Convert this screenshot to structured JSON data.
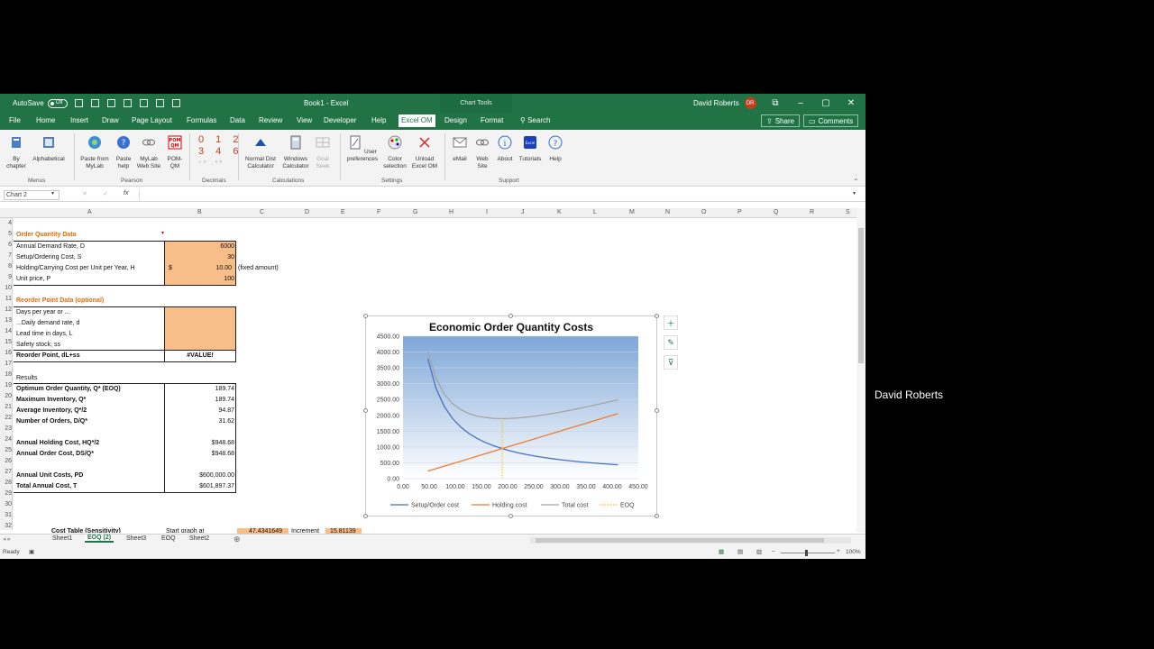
{
  "window": {
    "autosave_label": "AutoSave",
    "autosave_state": "Off",
    "doc_title": "Book1 - Excel",
    "chart_tools": "Chart Tools",
    "user_name": "David Roberts",
    "user_initials": "DR",
    "min": "–",
    "max": "▢",
    "close": "✕",
    "restore": "⧉"
  },
  "tabs": [
    "File",
    "Home",
    "Insert",
    "Draw",
    "Page Layout",
    "Formulas",
    "Data",
    "Review",
    "View",
    "Developer",
    "Help",
    "Excel OM",
    "Design",
    "Format"
  ],
  "search_label": "Search",
  "share_label": "Share",
  "comments_label": "Comments",
  "ribbon": {
    "buttons": [
      {
        "label": "By\nchapter",
        "icon": "chapter-icon"
      },
      {
        "label": "Alphabetical",
        "icon": "alphabetical-icon"
      },
      {
        "label": "Paste from\nMyLab",
        "icon": "mylab-icon"
      },
      {
        "label": "Paste\nhelp",
        "icon": "help-icon"
      },
      {
        "label": "MyLab\nWeb Site",
        "icon": "web-icon"
      },
      {
        "label": "POM-\nQM",
        "icon": "pomqm-icon"
      },
      {
        "label": "Normal Dist\nCalculator",
        "icon": "normal-dist-icon"
      },
      {
        "label": "Windows\nCalculator",
        "icon": "calculator-icon"
      },
      {
        "label": "Goal\nSeek",
        "icon": "goal-seek-icon"
      },
      {
        "label": "User\npreferences",
        "icon": "preferences-icon"
      },
      {
        "label": "Color\nselection",
        "icon": "color-icon"
      },
      {
        "label": "Unload\nExcel OM",
        "icon": "unload-icon"
      },
      {
        "label": "eMail",
        "icon": "mail-icon"
      },
      {
        "label": "Web\nSite",
        "icon": "link-icon"
      },
      {
        "label": "About",
        "icon": "info-icon"
      },
      {
        "label": "Tutorials",
        "icon": "tutorials-icon"
      },
      {
        "label": "Help",
        "icon": "question-icon"
      }
    ],
    "digits_top": "0 1 2",
    "digits_mid": "3 4 6",
    "digits_bot": "⁺⁰ .⁰⁰",
    "groups": [
      "Menus",
      "Pearson",
      "Decimals",
      "Calculations",
      "Settings",
      "Support"
    ],
    "pom_line1": "POM",
    "pom_line2": "QM",
    "tutorials_mark": "Excel"
  },
  "formula_bar": {
    "name_box": "Chart 2",
    "fx": "fx"
  },
  "columns": [
    "A",
    "B",
    "C",
    "D",
    "E",
    "F",
    "G",
    "H",
    "I",
    "J",
    "K",
    "L",
    "M",
    "N",
    "O",
    "P",
    "Q",
    "R",
    "S"
  ],
  "rows": [
    "4",
    "5",
    "6",
    "7",
    "8",
    "9",
    "10",
    "11",
    "12",
    "13",
    "14",
    "15",
    "16",
    "17",
    "18",
    "19",
    "20",
    "21",
    "22",
    "23",
    "24",
    "25",
    "26",
    "27",
    "28",
    "29",
    "30",
    "31",
    "32"
  ],
  "sheet": {
    "oq_header": "Order Quantity Data",
    "r6a": "Annual Demand Rate, D",
    "r6b": "6000",
    "r7a": "Setup/Ordering Cost, S",
    "r7b": "30",
    "r8a": "Holding/Carrying Cost per Unit per Year, H",
    "r8cur": "$",
    "r8b": "10.00",
    "r8c": "(fixed amount)",
    "r9a": "Unit price, P",
    "r9b": "100",
    "rp_header": "Reorder Point Data (optional)",
    "r12a": "Days per year or ...",
    "r13a": "...Daily demand rate, d",
    "r14a": "Lead time in days, L",
    "r15a": "Safety stock, ss",
    "r16a": "Reorder Point, dL+ss",
    "r16b": "#VALUE!",
    "results": "Results",
    "r19a": "Optimum Order Quantity, Q* (EOQ)",
    "r19b": "189.74",
    "r20a": "Maximum Inventory, Q*",
    "r20b": "189.74",
    "r21a": "Average Inventory, Q*/2",
    "r21b": "94.87",
    "r22a": "Number of Orders, D/Q*",
    "r22b": "31.62",
    "r24a": "Annual Holding Cost, HQ*/2",
    "r24b": "$948.68",
    "r25a": "Annual Order Cost, DS/Q*",
    "r25b": "$948.68",
    "r27a": "Annual Unit Costs, PD",
    "r27b": "$600,000.00",
    "r28a": "Total Annual Cost, T",
    "r28b": "$601,897.37",
    "r32a": "Cost Table (Sensitivity)",
    "r32b": "Start graph at",
    "r32c": "47.4341649",
    "r32d": "Increment",
    "r32e": "15.81139"
  },
  "sheet_tabs": [
    "Sheet1",
    "EOQ (2)",
    "Sheet3",
    "EOQ",
    "Sheet2"
  ],
  "status": {
    "ready": "Ready",
    "zoom": "100%"
  },
  "side_name": "David Roberts",
  "chart_tool_icons": [
    "plus-icon",
    "brush-icon",
    "filter-icon"
  ],
  "colors": {
    "setup": "#4472c4",
    "holding": "#ed7d31",
    "total": "#a5a5a5",
    "eoq": "#ffc000"
  },
  "chart_data": {
    "type": "line",
    "title": "Economic Order Quantity Costs",
    "xlim": [
      0,
      450
    ],
    "ylim": [
      0,
      4500
    ],
    "xticks": [
      "0.00",
      "50.00",
      "100.00",
      "150.00",
      "200.00",
      "250.00",
      "300.00",
      "350.00",
      "400.00",
      "450.00"
    ],
    "yticks": [
      "0.00",
      "500.00",
      "1000.00",
      "1500.00",
      "2000.00",
      "2500.00",
      "3000.00",
      "3500.00",
      "4000.00",
      "4500.00"
    ],
    "x": [
      47.43,
      63.25,
      79.06,
      94.87,
      110.68,
      126.49,
      142.3,
      158.11,
      173.93,
      189.74,
      205.55,
      221.36,
      237.17,
      252.98,
      268.79,
      284.6,
      300.42,
      316.23,
      332.04,
      347.85,
      363.66,
      379.47,
      395.28,
      411.09
    ],
    "series": [
      {
        "name": "Setup/Order cost",
        "values": [
          3795,
          2846,
          2277,
          1897,
          1626,
          1423,
          1265,
          1138,
          1035,
          949,
          876,
          813,
          759,
          712,
          670,
          632,
          599,
          569,
          542,
          517,
          495,
          474,
          455,
          438
        ]
      },
      {
        "name": "Holding cost",
        "values": [
          237,
          316,
          395,
          474,
          553,
          632,
          712,
          791,
          870,
          949,
          1028,
          1107,
          1186,
          1265,
          1344,
          1423,
          1502,
          1581,
          1660,
          1739,
          1818,
          1897,
          1976,
          2055
        ]
      },
      {
        "name": "Total cost",
        "values": [
          4032,
          3162,
          2672,
          2371,
          2179,
          2055,
          1977,
          1929,
          1905,
          1897,
          1904,
          1920,
          1945,
          1977,
          2014,
          2055,
          2101,
          2150,
          2202,
          2256,
          2313,
          2371,
          2431,
          2493
        ]
      },
      {
        "name": "EOQ",
        "values": [
          [
            189.74,
            0
          ],
          [
            189.74,
            1897
          ]
        ]
      }
    ],
    "legend": "bottom",
    "grid": true
  }
}
